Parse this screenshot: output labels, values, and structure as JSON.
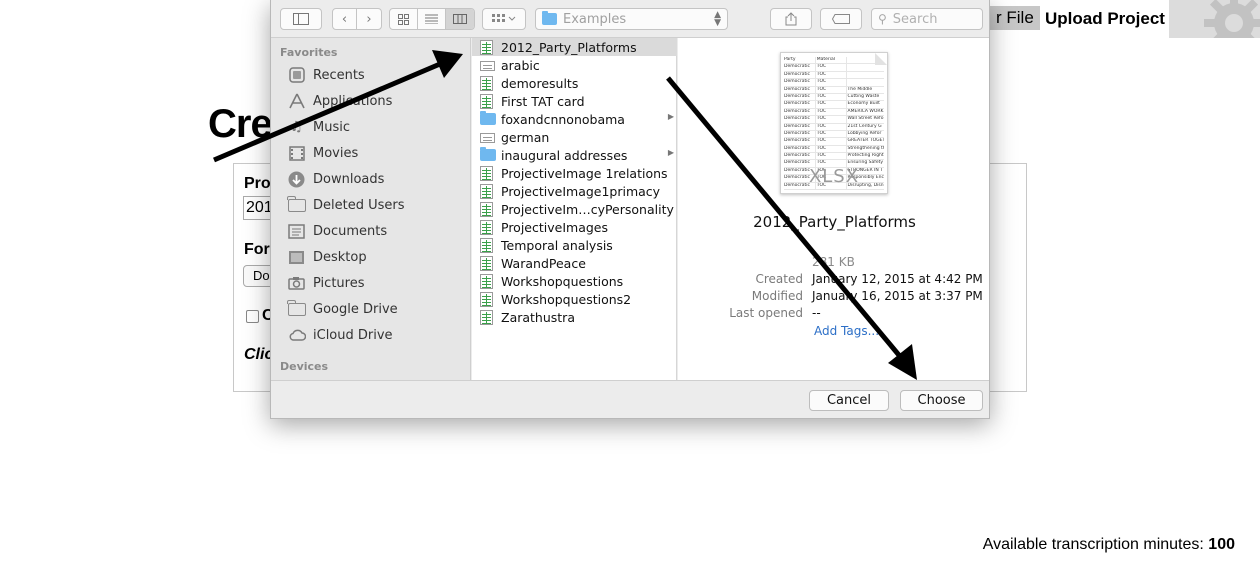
{
  "background": {
    "nav_file": "r File",
    "nav_upload": "Upload Project",
    "page_title": "Cre",
    "project_label": "Proj",
    "project_value": "201",
    "format_label": "Forr",
    "format_value": "Do",
    "checkbox_label": "C",
    "click_text": "Clic",
    "minutes_label": "Available transcription minutes:",
    "minutes_value": "100"
  },
  "dialog": {
    "toolbar": {
      "location": "Examples",
      "search_placeholder": "Search"
    },
    "sidebar": {
      "favorites_header": "Favorites",
      "devices_header": "Devices",
      "items": [
        {
          "label": "Recents",
          "icon": "clock-icon"
        },
        {
          "label": "Applications",
          "icon": "applications-icon"
        },
        {
          "label": "Music",
          "icon": "music-icon"
        },
        {
          "label": "Movies",
          "icon": "movies-icon"
        },
        {
          "label": "Downloads",
          "icon": "downloads-icon"
        },
        {
          "label": "Deleted Users",
          "icon": "folder-icon"
        },
        {
          "label": "Documents",
          "icon": "documents-icon"
        },
        {
          "label": "Desktop",
          "icon": "desktop-icon"
        },
        {
          "label": "Pictures",
          "icon": "camera-icon"
        },
        {
          "label": "Google Drive",
          "icon": "folder-icon"
        },
        {
          "label": "iCloud Drive",
          "icon": "cloud-icon"
        }
      ]
    },
    "files": [
      {
        "name": "2012_Party_Platforms",
        "type": "sheet",
        "selected": true
      },
      {
        "name": "arabic",
        "type": "doc"
      },
      {
        "name": "demoresults",
        "type": "sheet"
      },
      {
        "name": "First TAT card",
        "type": "sheet"
      },
      {
        "name": "foxandcnnonobama",
        "type": "folder"
      },
      {
        "name": "german",
        "type": "doc"
      },
      {
        "name": "inaugural addresses",
        "type": "folder"
      },
      {
        "name": "ProjectiveImage 1relations",
        "type": "sheet"
      },
      {
        "name": "ProjectiveImage1primacy",
        "type": "sheet"
      },
      {
        "name": "ProjectiveIm…cyPersonality",
        "type": "sheet"
      },
      {
        "name": "ProjectiveImages",
        "type": "sheet"
      },
      {
        "name": "Temporal analysis",
        "type": "sheet"
      },
      {
        "name": "WarandPeace",
        "type": "sheet"
      },
      {
        "name": "Workshopquestions",
        "type": "sheet"
      },
      {
        "name": "Workshopquestions2",
        "type": "sheet"
      },
      {
        "name": "Zarathustra",
        "type": "sheet"
      }
    ],
    "preview": {
      "thumbnail_ext": "XLSX",
      "thumbnail_rows": [
        [
          "Party",
          "Material",
          ""
        ],
        [
          "Democratic",
          "TOC",
          ""
        ],
        [
          "Democratic",
          "TOC",
          ""
        ],
        [
          "Democratic",
          "TOC",
          ""
        ],
        [
          "Democratic",
          "TOC",
          "The Middle"
        ],
        [
          "Democratic",
          "TOC",
          "Cutting Waste"
        ],
        [
          "Democratic",
          "TOC",
          "Economy Built"
        ],
        [
          "Democratic",
          "TOC",
          "AMERICA WORK"
        ],
        [
          "Democratic",
          "TOC",
          "Wall Street Refo"
        ],
        [
          "Democratic",
          "TOC",
          "21st Century G"
        ],
        [
          "Democratic",
          "TOC",
          "Lobbying Refor"
        ],
        [
          "Democratic",
          "TOC",
          "GREATER TOGET"
        ],
        [
          "Democratic",
          "TOC",
          "Strengthening th"
        ],
        [
          "Democratic",
          "TOC",
          "Protecting Right"
        ],
        [
          "Democratic",
          "TOC",
          "Ensuring Safety"
        ],
        [
          "Democratic",
          "TOC",
          "STRONGER IN T"
        ],
        [
          "Democratic",
          "TOC",
          "Responsibly Enc"
        ],
        [
          "Democratic",
          "TOC",
          "Disrupting, Disn"
        ]
      ],
      "file_name": "2012_Party_Platforms",
      "size": "281 KB",
      "created_label": "Created",
      "created_value": "January 12, 2015 at 4:42 PM",
      "modified_label": "Modified",
      "modified_value": "January 16, 2015 at 3:37 PM",
      "last_opened_label": "Last opened",
      "last_opened_value": "--",
      "add_tags": "Add Tags..."
    },
    "buttons": {
      "cancel": "Cancel",
      "choose": "Choose"
    }
  }
}
